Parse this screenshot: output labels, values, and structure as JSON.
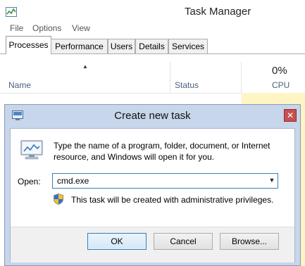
{
  "task_manager": {
    "title": "Task Manager",
    "menu": [
      "File",
      "Options",
      "View"
    ],
    "tabs": [
      "Processes",
      "Performance",
      "Users",
      "Details",
      "Services"
    ],
    "active_tab": "Processes",
    "columns": {
      "name": "Name",
      "status": "Status",
      "cpu_percent": "0%",
      "cpu": "CPU"
    }
  },
  "dialog": {
    "title": "Create new task",
    "close_glyph": "✕",
    "prompt": "Type the name of a program, folder, document, or Internet resource, and Windows will open it for you.",
    "open_label": "Open:",
    "open_value": "cmd.exe",
    "admin_note": "This task will be created with administrative privileges.",
    "buttons": {
      "ok": "OK",
      "cancel": "Cancel",
      "browse": "Browse..."
    }
  },
  "colors": {
    "dialog_frame": "#c7d6ea",
    "close_button": "#c75050",
    "column_header_text": "#4d6082",
    "cpu_highlight": "#fff4c4"
  }
}
